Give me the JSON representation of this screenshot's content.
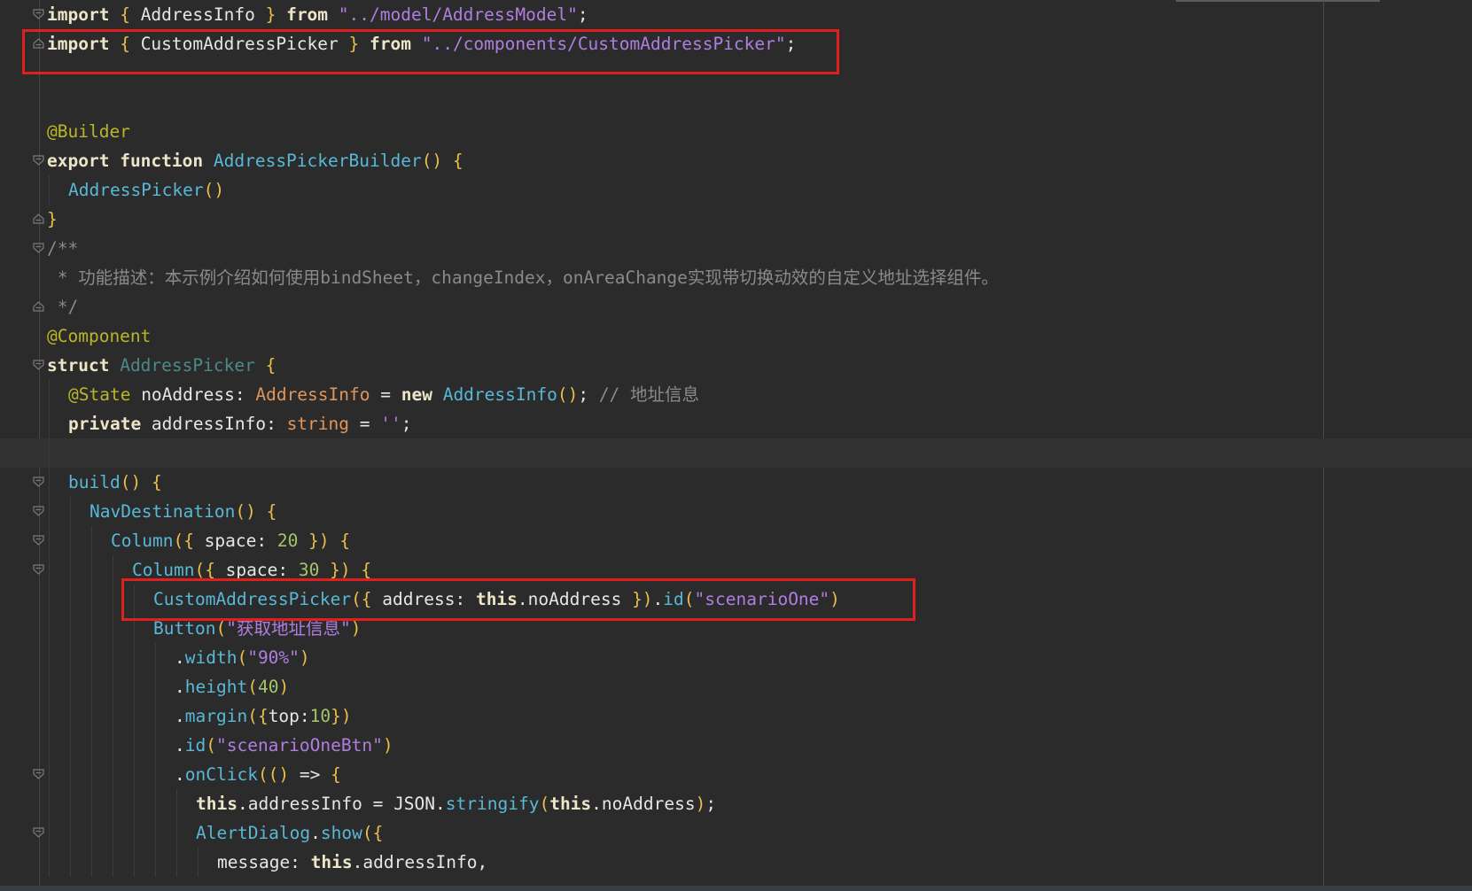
{
  "editor": {
    "lines": [
      {
        "fold": "open",
        "indent": 0,
        "tokens": [
          [
            "kw2",
            "import"
          ],
          [
            "pl",
            " "
          ],
          [
            "br",
            "{"
          ],
          [
            "pl",
            " AddressInfo "
          ],
          [
            "br",
            "}"
          ],
          [
            "pl",
            " "
          ],
          [
            "kw2",
            "from"
          ],
          [
            "pl",
            " "
          ],
          [
            "str",
            "\"../model/AddressModel\""
          ],
          [
            "pl",
            ";"
          ]
        ]
      },
      {
        "fold": "end",
        "indent": 0,
        "tokens": [
          [
            "kw2",
            "import"
          ],
          [
            "pl",
            " "
          ],
          [
            "br",
            "{"
          ],
          [
            "pl",
            " CustomAddressPicker "
          ],
          [
            "br",
            "}"
          ],
          [
            "pl",
            " "
          ],
          [
            "kw2",
            "from"
          ],
          [
            "pl",
            " "
          ],
          [
            "str",
            "\"../components/CustomAddressPicker\""
          ],
          [
            "pl",
            ";"
          ]
        ]
      },
      {
        "fold": "",
        "indent": 0,
        "tokens": []
      },
      {
        "fold": "",
        "indent": 0,
        "tokens": []
      },
      {
        "fold": "",
        "indent": 0,
        "tokens": [
          [
            "ann",
            "@Builder"
          ]
        ]
      },
      {
        "fold": "open",
        "indent": 0,
        "tokens": [
          [
            "kw2",
            "export"
          ],
          [
            "pl",
            " "
          ],
          [
            "kw2",
            "function"
          ],
          [
            "pl",
            " "
          ],
          [
            "fn",
            "AddressPickerBuilder"
          ],
          [
            "br",
            "()"
          ],
          [
            "pl",
            " "
          ],
          [
            "br",
            "{"
          ]
        ]
      },
      {
        "fold": "",
        "indent": 1,
        "tokens": [
          [
            "fn",
            "AddressPicker"
          ],
          [
            "br",
            "()"
          ]
        ]
      },
      {
        "fold": "end",
        "indent": 0,
        "tokens": [
          [
            "br",
            "}"
          ]
        ]
      },
      {
        "fold": "open",
        "indent": 0,
        "tokens": [
          [
            "cm",
            "/**"
          ]
        ]
      },
      {
        "fold": "",
        "indent": 0,
        "tokens": [
          [
            "cm",
            " * 功能描述：本示例介绍如何使用bindSheet，changeIndex，onAreaChange实现带切换动效的自定义地址选择组件。"
          ]
        ]
      },
      {
        "fold": "end",
        "indent": 0,
        "tokens": [
          [
            "cm",
            " */"
          ]
        ]
      },
      {
        "fold": "",
        "indent": 0,
        "tokens": [
          [
            "ann",
            "@Component"
          ]
        ]
      },
      {
        "fold": "open",
        "indent": 0,
        "tokens": [
          [
            "kw2",
            "struct"
          ],
          [
            "pl",
            " "
          ],
          [
            "st",
            "AddressPicker"
          ],
          [
            "pl",
            " "
          ],
          [
            "br",
            "{"
          ]
        ]
      },
      {
        "fold": "",
        "indent": 1,
        "tokens": [
          [
            "ann",
            "@State"
          ],
          [
            "pl",
            " noAddress: "
          ],
          [
            "ty",
            "AddressInfo"
          ],
          [
            "pl",
            " = "
          ],
          [
            "kw2",
            "new"
          ],
          [
            "pl",
            " "
          ],
          [
            "fn",
            "AddressInfo"
          ],
          [
            "br",
            "()"
          ],
          [
            "pl",
            "; "
          ],
          [
            "cm",
            "// 地址信息"
          ]
        ]
      },
      {
        "fold": "",
        "indent": 1,
        "tokens": [
          [
            "kw2",
            "private"
          ],
          [
            "pl",
            " addressInfo: "
          ],
          [
            "ty",
            "string"
          ],
          [
            "pl",
            " = "
          ],
          [
            "str",
            "''"
          ],
          [
            "pl",
            ";"
          ]
        ]
      },
      {
        "fold": "",
        "indent": 1,
        "current": true,
        "tokens": []
      },
      {
        "fold": "open",
        "indent": 1,
        "tokens": [
          [
            "fn",
            "build"
          ],
          [
            "br",
            "()"
          ],
          [
            "pl",
            " "
          ],
          [
            "br",
            "{"
          ]
        ]
      },
      {
        "fold": "open",
        "indent": 2,
        "tokens": [
          [
            "fn",
            "NavDestination"
          ],
          [
            "br",
            "()"
          ],
          [
            "pl",
            " "
          ],
          [
            "br",
            "{"
          ]
        ]
      },
      {
        "fold": "open",
        "indent": 3,
        "tokens": [
          [
            "fn",
            "Column"
          ],
          [
            "br",
            "({"
          ],
          [
            "pl",
            " space: "
          ],
          [
            "num",
            "20"
          ],
          [
            "pl",
            " "
          ],
          [
            "br",
            "})"
          ],
          [
            "pl",
            " "
          ],
          [
            "br",
            "{"
          ]
        ]
      },
      {
        "fold": "open",
        "indent": 4,
        "tokens": [
          [
            "fn",
            "Column"
          ],
          [
            "br",
            "({"
          ],
          [
            "pl",
            " space: "
          ],
          [
            "num",
            "30"
          ],
          [
            "pl",
            " "
          ],
          [
            "br",
            "})"
          ],
          [
            "pl",
            " "
          ],
          [
            "br",
            "{"
          ]
        ]
      },
      {
        "fold": "",
        "indent": 5,
        "tokens": [
          [
            "fn",
            "CustomAddressPicker"
          ],
          [
            "br",
            "({"
          ],
          [
            "pl",
            " address: "
          ],
          [
            "kw2",
            "this"
          ],
          [
            "pl",
            ".noAddress "
          ],
          [
            "br",
            "})"
          ],
          [
            "pl",
            "."
          ],
          [
            "fn",
            "id"
          ],
          [
            "br",
            "("
          ],
          [
            "str",
            "\"scenarioOne\""
          ],
          [
            "br",
            ")"
          ]
        ]
      },
      {
        "fold": "",
        "indent": 5,
        "tokens": [
          [
            "fn",
            "Button"
          ],
          [
            "br",
            "("
          ],
          [
            "str",
            "\"获取地址信息\""
          ],
          [
            "br",
            ")"
          ]
        ]
      },
      {
        "fold": "",
        "indent": 6,
        "tokens": [
          [
            "pl",
            "."
          ],
          [
            "fn",
            "width"
          ],
          [
            "br",
            "("
          ],
          [
            "str",
            "\"90%\""
          ],
          [
            "br",
            ")"
          ]
        ]
      },
      {
        "fold": "",
        "indent": 6,
        "tokens": [
          [
            "pl",
            "."
          ],
          [
            "fn",
            "height"
          ],
          [
            "br",
            "("
          ],
          [
            "num",
            "40"
          ],
          [
            "br",
            ")"
          ]
        ]
      },
      {
        "fold": "",
        "indent": 6,
        "tokens": [
          [
            "pl",
            "."
          ],
          [
            "fn",
            "margin"
          ],
          [
            "br",
            "({"
          ],
          [
            "pl",
            "top:"
          ],
          [
            "num",
            "10"
          ],
          [
            "br",
            "})"
          ]
        ]
      },
      {
        "fold": "",
        "indent": 6,
        "tokens": [
          [
            "pl",
            "."
          ],
          [
            "fn",
            "id"
          ],
          [
            "br",
            "("
          ],
          [
            "str",
            "\"scenarioOneBtn\""
          ],
          [
            "br",
            ")"
          ]
        ]
      },
      {
        "fold": "open",
        "indent": 6,
        "tokens": [
          [
            "pl",
            "."
          ],
          [
            "fn",
            "onClick"
          ],
          [
            "br",
            "(()"
          ],
          [
            "pl",
            " => "
          ],
          [
            "br",
            "{"
          ]
        ]
      },
      {
        "fold": "",
        "indent": 7,
        "tokens": [
          [
            "kw2",
            "this"
          ],
          [
            "pl",
            ".addressInfo = JSON."
          ],
          [
            "fn",
            "stringify"
          ],
          [
            "br",
            "("
          ],
          [
            "kw2",
            "this"
          ],
          [
            "pl",
            ".noAddress"
          ],
          [
            "br",
            ")"
          ],
          [
            "pl",
            ";"
          ]
        ]
      },
      {
        "fold": "open",
        "indent": 7,
        "tokens": [
          [
            "fn",
            "AlertDialog"
          ],
          [
            "pl",
            "."
          ],
          [
            "fn",
            "show"
          ],
          [
            "br",
            "({"
          ]
        ]
      },
      {
        "fold": "",
        "indent": 8,
        "tokens": [
          [
            "pl",
            "message: "
          ],
          [
            "kw2",
            "this"
          ],
          [
            "pl",
            ".addressInfo,"
          ]
        ]
      }
    ]
  }
}
